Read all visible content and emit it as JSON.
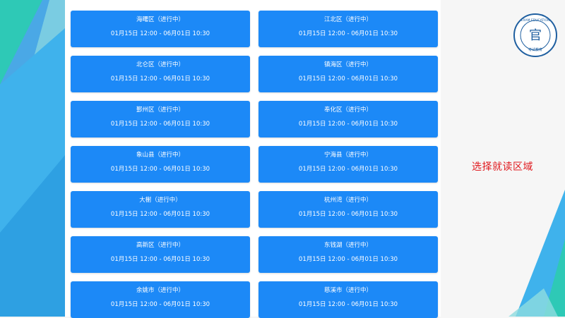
{
  "colors": {
    "card": "#1c89f7",
    "hint": "#e0191e",
    "accent": "#2bb9c5"
  },
  "logo": {
    "text": "EXAM EDUCATION",
    "glyph": "官",
    "sub": "考试教育"
  },
  "hint": "选择就读区域",
  "regions": [
    {
      "name": "海曙区（进行中）",
      "time": "01月15日 12:00 - 06月01日 10:30"
    },
    {
      "name": "江北区（进行中）",
      "time": "01月15日 12:00 - 06月01日 10:30"
    },
    {
      "name": "北仑区（进行中）",
      "time": "01月15日 12:00 - 06月01日 10:30"
    },
    {
      "name": "镇海区（进行中）",
      "time": "01月15日 12:00 - 06月01日 10:30"
    },
    {
      "name": "鄞州区（进行中）",
      "time": "01月15日 12:00 - 06月01日 10:30"
    },
    {
      "name": "奉化区（进行中）",
      "time": "01月15日 12:00 - 06月01日 10:30"
    },
    {
      "name": "象山县（进行中）",
      "time": "01月15日 12:00 - 06月01日 10:30"
    },
    {
      "name": "宁海县（进行中）",
      "time": "01月15日 12:00 - 06月01日 10:30"
    },
    {
      "name": "大榭（进行中）",
      "time": "01月15日 12:00 - 06月01日 10:30"
    },
    {
      "name": "杭州湾（进行中）",
      "time": "01月15日 12:00 - 06月01日 10:30"
    },
    {
      "name": "高新区（进行中）",
      "time": "01月15日 12:00 - 06月01日 10:30"
    },
    {
      "name": "东钱湖（进行中）",
      "time": "01月15日 12:00 - 06月01日 10:30"
    },
    {
      "name": "余姚市（进行中）",
      "time": "01月15日 12:00 - 06月01日 10:30"
    },
    {
      "name": "慈溪市（进行中）",
      "time": "01月15日 12:00 - 06月01日 10:30"
    }
  ]
}
